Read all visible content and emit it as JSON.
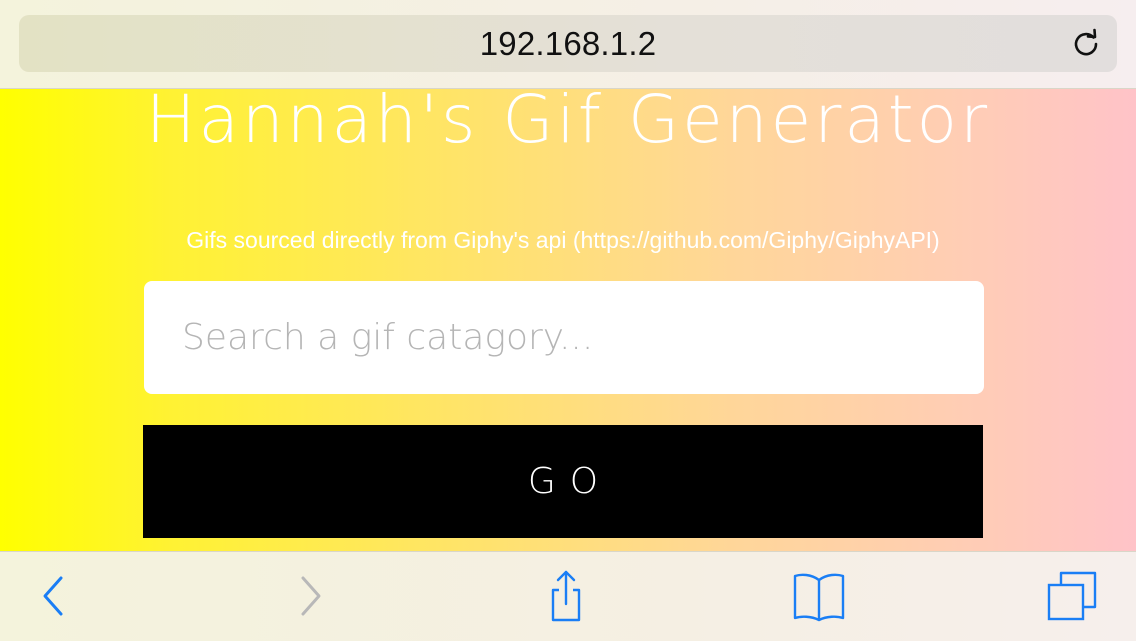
{
  "browser": {
    "url": "192.168.1.2",
    "accent_color": "#1a7ef5",
    "disabled_color": "#b8b8b8",
    "icons": [
      "reload-icon",
      "back-icon",
      "forward-icon",
      "share-icon",
      "bookmarks-icon",
      "tabs-icon"
    ]
  },
  "page": {
    "title": "Hannah's Gif Generator",
    "subtitle": "Gifs sourced directly from Giphy's api (https://github.com/Giphy/GiphyAPI)",
    "search": {
      "placeholder": "Search a gif catagory...",
      "value": ""
    },
    "go_label": "GO",
    "gradient_colors": [
      "#ffff00",
      "#ffc3c8"
    ]
  }
}
